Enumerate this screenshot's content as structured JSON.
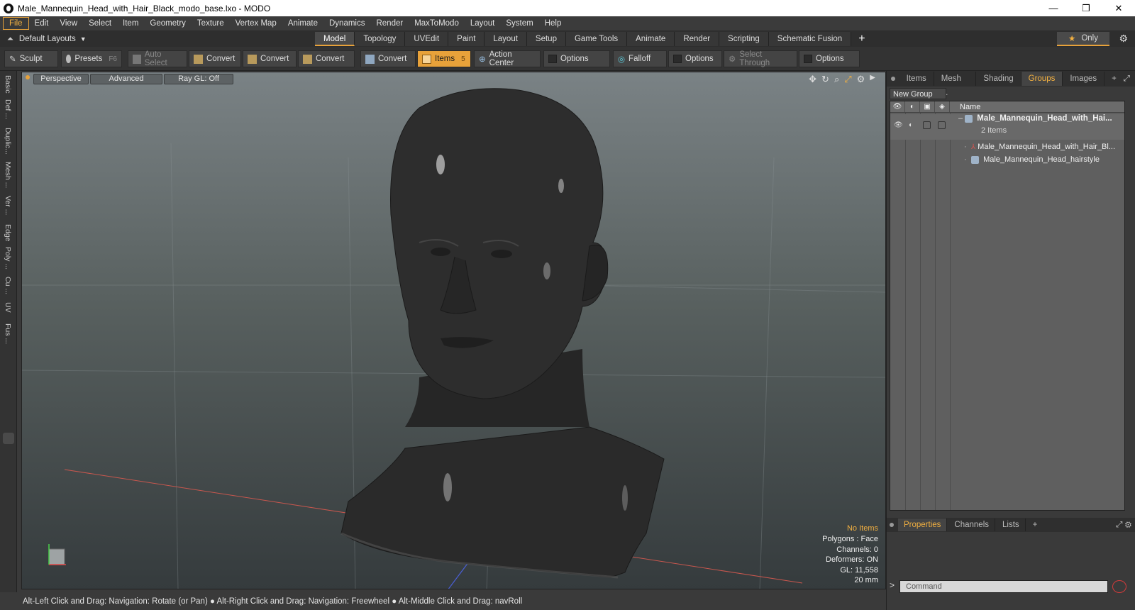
{
  "window": {
    "title": "Male_Mannequin_Head_with_Hair_Black_modo_base.lxo - MODO",
    "controls": [
      "—",
      "❐",
      "✕"
    ]
  },
  "menu": [
    "File",
    "Edit",
    "View",
    "Select",
    "Item",
    "Geometry",
    "Texture",
    "Vertex Map",
    "Animate",
    "Dynamics",
    "Render",
    "MaxToModo",
    "Layout",
    "System",
    "Help"
  ],
  "layout_row": {
    "layouts_label": "Default Layouts",
    "tabs": [
      "Model",
      "Topology",
      "UVEdit",
      "Paint",
      "Layout",
      "Setup",
      "Game Tools",
      "Animate",
      "Render",
      "Scripting",
      "Schematic Fusion"
    ],
    "selected_tab": "Model",
    "plus": "+",
    "only_label": "Only",
    "only_star": "★"
  },
  "toolbar": {
    "sculpt": "Sculpt",
    "presets": "Presets",
    "presets_key": "F6",
    "auto_select": "Auto Select",
    "convert1": "Convert",
    "convert2": "Convert",
    "convert3": "Convert",
    "convert4": "Convert",
    "items": "Items",
    "items_key": "5",
    "action_center": "Action Center",
    "options1": "Options",
    "falloff": "Falloff",
    "options2": "Options",
    "select_through": "Select Through",
    "options3": "Options"
  },
  "left_tabs": [
    "Basic",
    "Def ...",
    "Duplic...",
    "Mesh ...",
    "Ver ...",
    "Edge",
    "Poly ...",
    "Cu ...",
    "UV",
    "Fus ..."
  ],
  "viewport": {
    "perspective": "Perspective",
    "advanced": "Advanced",
    "raygl": "Ray GL: Off",
    "stats": {
      "no_items": "No Items",
      "polygons": "Polygons : Face",
      "channels": "Channels: 0",
      "deformers": "Deformers: ON",
      "gl": "GL: 11,558",
      "scale": "20 mm"
    }
  },
  "status_bar": "Alt-Left Click and Drag: Navigation: Rotate (or Pan) ● Alt-Right Click and Drag: Navigation: Freewheel ● Alt-Middle Click and Drag: navRoll",
  "right_panel": {
    "tabs": [
      "Items",
      "Mesh ...",
      "Shading",
      "Groups",
      "Images"
    ],
    "selected_tab": "Groups",
    "plus": "+",
    "new_group": "New Group",
    "name_header": "Name",
    "tree": {
      "group_name": "Male_Mannequin_Head_with_Hai...",
      "group_count": "2 Items",
      "child1": "Male_Mannequin_Head_with_Hair_Bl...",
      "child2": "Male_Mannequin_Head_hairstyle"
    },
    "bottom_tabs": [
      "Properties",
      "Channels",
      "Lists"
    ],
    "bottom_selected": "Properties",
    "command_placeholder": "Command",
    "command_prompt": ">"
  },
  "colors": {
    "accent": "#e8a23a",
    "panel": "#3a3a3a",
    "list_bg": "#5f5f5f",
    "mesh": "#2a2a2a"
  }
}
